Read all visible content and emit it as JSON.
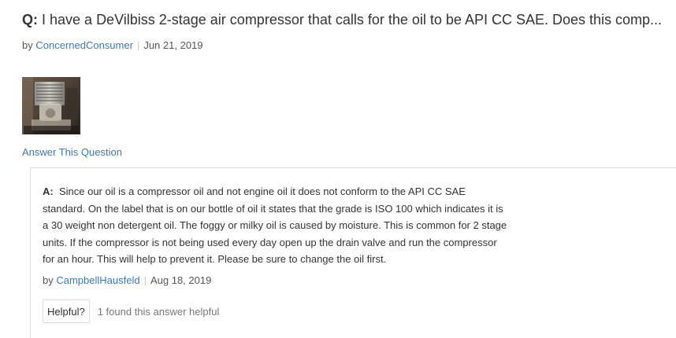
{
  "question": {
    "prefix": "Q:",
    "text": "I have a DeVilbiss 2-stage air compressor that calls for the oil to be API CC SAE. Does this comp...",
    "by_label": "by",
    "author": "ConcernedConsumer",
    "date": "Jun 21, 2019",
    "image_alt": "Photo of air compressor oil"
  },
  "answer_this_question": "Answer This Question",
  "answer": {
    "prefix": "A:",
    "lines": [
      "Since our oil is a compressor oil and not engine oil it does not conform to the API CC SAE",
      "standard. On the label that is on our bottle of oil it states that the grade is ISO 100 which indicates it is",
      "a 30 weight non detergent oil. The foggy or milky oil is caused by moisture. This is common for 2 stage",
      "units. If the compressor is not being used every day open up the drain valve and run the compressor",
      "for an hour. This will help to prevent it. Please be sure to change the oil first."
    ],
    "by_label": "by",
    "author": "CampbellHausfeld",
    "date": "Aug 18, 2019",
    "helpful_button": "Helpful?",
    "helpful_count": "1 found this answer helpful"
  },
  "colors": {
    "link": "#3a7ab8",
    "text": "#333333",
    "border": "#dcdcdc"
  }
}
